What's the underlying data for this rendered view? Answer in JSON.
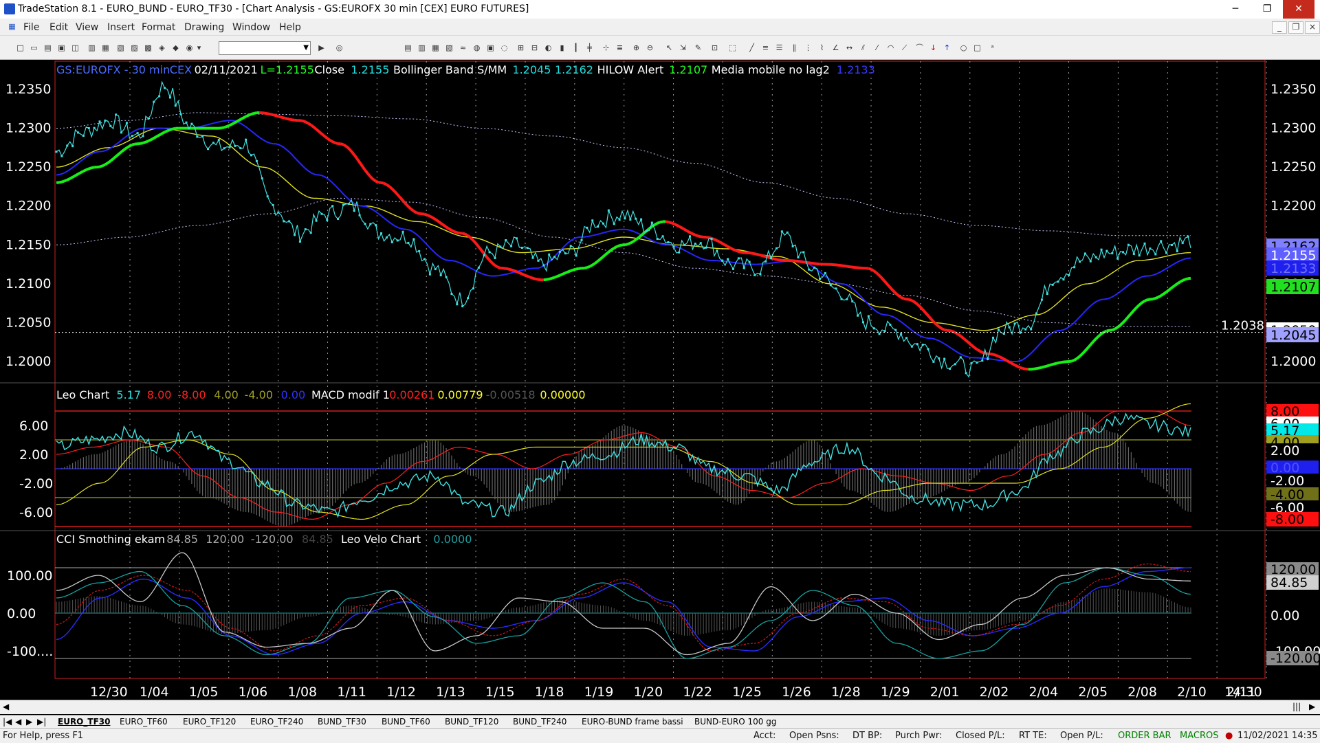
{
  "window": {
    "title": "TradeStation 8.1 - EURO_BUND - EURO_TF30 - [Chart Analysis - GS:EUROFX  30 min  [CEX] EURO FUTURES]",
    "minimize": "─",
    "maximize": "❐",
    "close": "✕"
  },
  "menu": [
    "File",
    "Edit",
    "View",
    "Insert",
    "Format",
    "Drawing",
    "Window",
    "Help"
  ],
  "mdi_controls": [
    "_",
    "❐",
    "×"
  ],
  "toolbar": {
    "combo_value": ""
  },
  "chart": {
    "price_header": [
      {
        "text": "GS:EUROFX - 30 min",
        "color": "#4a6cff"
      },
      {
        "text": "CEX",
        "color": "#4a6cff"
      },
      {
        "text": "02/11/2021",
        "color": "#ffffff"
      },
      {
        "text": "L=1.2155",
        "color": "#22ff22"
      },
      {
        "text": "Close",
        "color": "#ffffff"
      },
      {
        "text": "1.2155",
        "color": "#22e0e0"
      },
      {
        "text": "Bollinger Band S/MM",
        "color": "#ffffff"
      },
      {
        "text": "1.2045",
        "color": "#22e0e0"
      },
      {
        "text": "1.2162",
        "color": "#22e0e0"
      },
      {
        "text": "HILOW Alert",
        "color": "#ffffff"
      },
      {
        "text": "1.2107",
        "color": "#22ff22"
      },
      {
        "text": "Media mobile no lag2",
        "color": "#ffffff"
      },
      {
        "text": "1.2133",
        "color": "#3a3aff"
      }
    ],
    "leo_header": [
      {
        "text": "Leo Chart",
        "color": "#ffffff"
      },
      {
        "text": "5.17",
        "color": "#22e0e0"
      },
      {
        "text": "8.00",
        "color": "#ff2020"
      },
      {
        "text": "-8.00",
        "color": "#ff2020"
      },
      {
        "text": "4.00",
        "color": "#a0a020"
      },
      {
        "text": "-4.00",
        "color": "#a0a020"
      },
      {
        "text": "0.00",
        "color": "#3030ff"
      },
      {
        "text": "MACD modif 1",
        "color": "#ffffff"
      },
      {
        "text": "0.00261",
        "color": "#ff2020"
      },
      {
        "text": "0.00779",
        "color": "#ffff20"
      },
      {
        "text": "-0.00518",
        "color": "#555555"
      },
      {
        "text": "0.00000",
        "color": "#ffff20"
      }
    ],
    "cci_header": [
      {
        "text": "CCI Smothing ekam",
        "color": "#ffffff"
      },
      {
        "text": "84.85",
        "color": "#aaaaaa"
      },
      {
        "text": "120.00",
        "color": "#aaaaaa"
      },
      {
        "text": "-120.00",
        "color": "#aaaaaa"
      },
      {
        "text": "84.85",
        "color": "#444444"
      },
      {
        "text": "Leo Velo Chart",
        "color": "#ffffff"
      },
      {
        "text": "0.0000",
        "color": "#1ea0a0"
      }
    ],
    "price_axis_left": [
      "1.2350",
      "1.2300",
      "1.2250",
      "1.2200",
      "1.2150",
      "1.2100",
      "1.2050",
      "1.2000"
    ],
    "price_axis_right": [
      "1.2350",
      "1.2300",
      "1.2250",
      "1.2200",
      "1.2100",
      "1.2000"
    ],
    "price_right_badges": [
      {
        "text": "1.2162",
        "bg": "#8080ff",
        "fg": "#000000"
      },
      {
        "text": "1.2155",
        "bg": "#6060ff",
        "fg": "#ffffff"
      },
      {
        "text": "1.2133",
        "bg": "#2020ee",
        "fg": "#7070ff"
      },
      {
        "text": "1.2107",
        "bg": "#20e020",
        "fg": "#000000"
      },
      {
        "text": "1.2050",
        "bg": "#ffffff",
        "fg": "#000000"
      },
      {
        "text": "1.2045",
        "bg": "#a0a0ff",
        "fg": "#000000"
      }
    ],
    "cursor_price": "1.2038",
    "leo_axis_left": [
      "6.00",
      "2.00",
      "-2.00",
      "-6.00"
    ],
    "leo_right_badges": [
      {
        "text": "8.00",
        "bg": "#ff1010",
        "fg": "#000000"
      },
      {
        "text": "6.00",
        "bg": "#ffffff",
        "fg": "#000000"
      },
      {
        "text": "5.17",
        "bg": "#00e8e8",
        "fg": "#000000"
      },
      {
        "text": "4.00",
        "bg": "#a0a020",
        "fg": "#000000"
      },
      {
        "text": "2.00",
        "bg": "#000000",
        "fg": "#ffffff"
      },
      {
        "text": "0.00",
        "bg": "#2020ee",
        "fg": "#5050ff"
      },
      {
        "text": "-2.00",
        "bg": "#000000",
        "fg": "#ffffff"
      },
      {
        "text": "-4.00",
        "bg": "#707018",
        "fg": "#000000"
      },
      {
        "text": "-6.00",
        "bg": "#000000",
        "fg": "#ffffff"
      },
      {
        "text": "-8.00",
        "bg": "#ff1010",
        "fg": "#000000"
      }
    ],
    "cci_axis_left": [
      "100.00",
      "0.00",
      "-100...."
    ],
    "cci_right_badges": [
      {
        "text": "120.00",
        "bg": "#8a8a8a",
        "fg": "#000000"
      },
      {
        "text": "84.85",
        "bg": "#d0d0d0",
        "fg": "#000000"
      },
      {
        "text": "0.00",
        "bg": "#000000",
        "fg": "#ffffff"
      },
      {
        "text": "-100.00",
        "bg": "#000000",
        "fg": "#ffffff"
      },
      {
        "text": "-120.00",
        "bg": "#8a8a8a",
        "fg": "#000000"
      }
    ],
    "date_axis": [
      "12/30",
      "1/04",
      "1/05",
      "1/06",
      "1/08",
      "1/11",
      "1/12",
      "1/13",
      "1/15",
      "1/18",
      "1/19",
      "1/20",
      "1/22",
      "1/25",
      "1/26",
      "1/28",
      "1/29",
      "2/01",
      "2/02",
      "2/04",
      "2/05",
      "2/08",
      "2/10",
      "2/11",
      "14:30"
    ]
  },
  "tabs": [
    "EURO_TF30",
    "EURO_TF60",
    "EURO_TF120",
    "EURO_TF240",
    "BUND_TF30",
    "BUND_TF60",
    "BUND_TF120",
    "BUND_TF240",
    "EURO-BUND frame bassi",
    "BUND-EURO 100 gg"
  ],
  "tab_nav": [
    "|◀",
    "◀",
    "▶",
    "▶|"
  ],
  "status": {
    "help": "For Help, press F1",
    "acct": "Acct:",
    "open_psns": "Open Psns:",
    "dt_bp": "DT BP:",
    "purch_pwr": "Purch Pwr:",
    "closed_pl": "Closed P/L:",
    "rt_te": "RT TE:",
    "open_pl": "Open P/L:",
    "order_bar": "ORDER BAR",
    "macros": "MACROS",
    "datetime": "11/02/2021 14:35"
  },
  "colors": {
    "red": "#ff2020",
    "green": "#22ee22",
    "blue": "#2222ff",
    "yellow": "#d8d820",
    "cyan": "#40e0e0",
    "status_green": "#008000"
  }
}
